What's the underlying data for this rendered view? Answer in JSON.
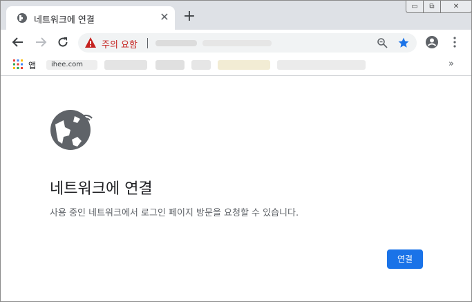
{
  "tab": {
    "title": "네트워크에 연결",
    "close_glyph": "✕",
    "new_tab_glyph": "+"
  },
  "window_controls": {
    "minimize": "▭",
    "maximize": "⧉",
    "close": "✕"
  },
  "omnibox": {
    "security_text": "주의 요함",
    "security_icon": "warning-triangle-icon",
    "url": "[redacted]"
  },
  "bookmarks": {
    "apps_label": "앱",
    "site_label": "ihee.com",
    "more_glyph": "»"
  },
  "content": {
    "title": "네트워크에 연결",
    "description": "사용 중인 네트워크에서 로그인 페이지 방문을 요청할 수 있습니다.",
    "connect_button": "연결"
  },
  "colors": {
    "accent": "#1a73e8",
    "warning": "#c5221f",
    "icon_gray": "#5f6368"
  }
}
